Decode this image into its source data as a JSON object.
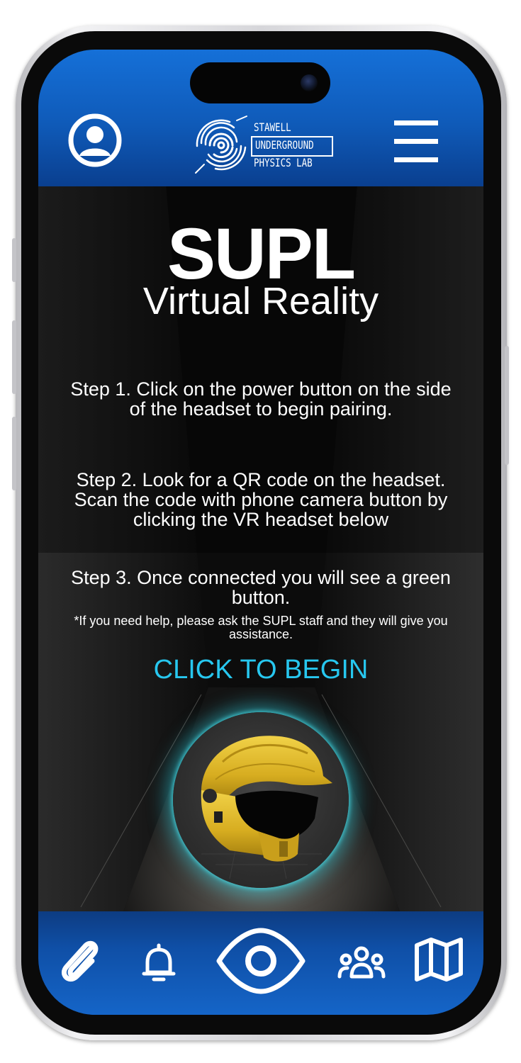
{
  "header": {
    "profile_icon": "profile-icon",
    "menu_icon": "hamburger-menu-icon",
    "logo": {
      "line1": "STAWELL",
      "line2": "UNDERGROUND",
      "line3": "PHYSICS LAB"
    }
  },
  "main": {
    "title": "SUPL",
    "subtitle": "Virtual Reality",
    "steps": [
      {
        "text": "Step 1. Click on the power button on the side of the headset to begin pairing."
      },
      {
        "text": "Step 2. Look for a QR code on the headset. Scan the code with phone camera button by clicking the VR headset below"
      },
      {
        "text": "Step 3. Once connected you will see a green button."
      }
    ],
    "help_note": "*If you need help, please ask the SUPL staff and they will give you assistance.",
    "cta_label": "CLICK TO BEGIN",
    "helmet_icon": "vr-helmet-image"
  },
  "bottom_nav": {
    "items": [
      {
        "icon": "paperclip-icon"
      },
      {
        "icon": "bell-icon"
      },
      {
        "icon": "eye-icon"
      },
      {
        "icon": "users-icon"
      },
      {
        "icon": "map-icon"
      }
    ]
  },
  "colors": {
    "header_blue": "#1570d8",
    "accent_cyan": "#27c7ef",
    "helmet_yellow": "#e8c22a"
  }
}
